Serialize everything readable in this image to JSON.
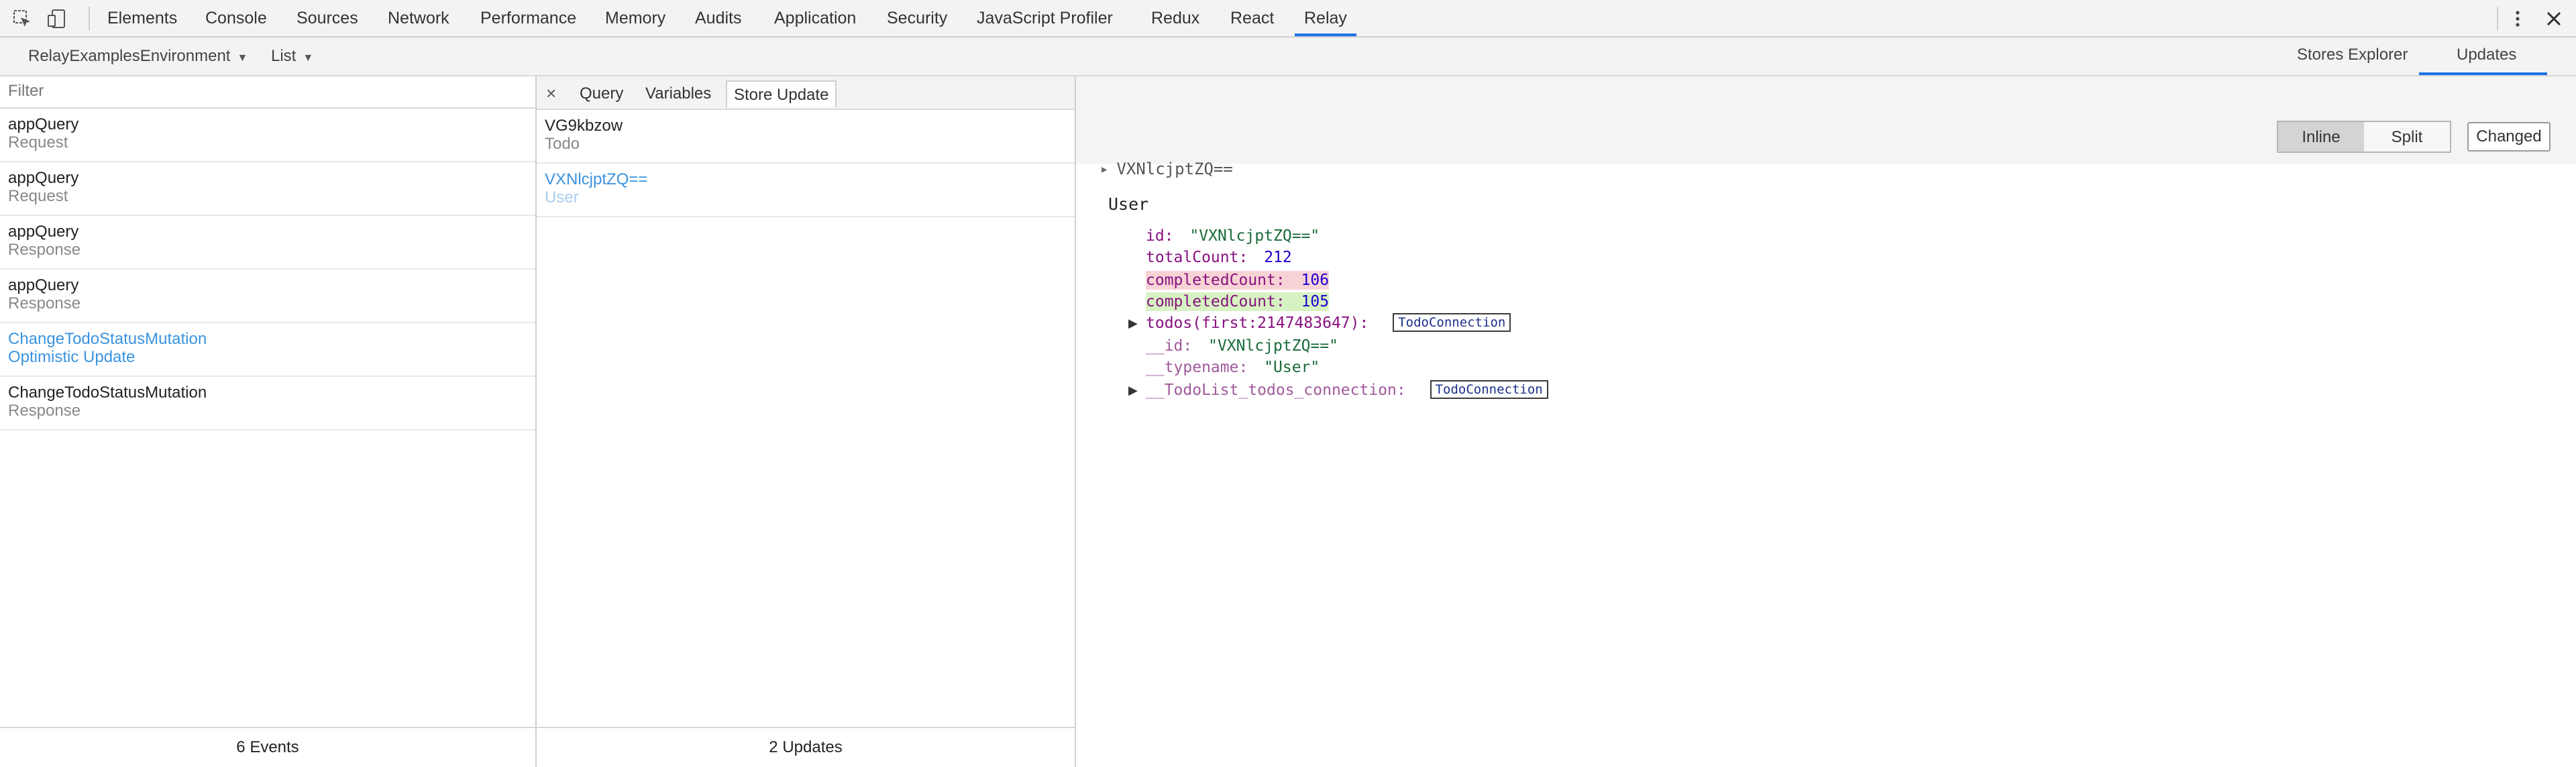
{
  "devtools": {
    "tabs": [
      "Elements",
      "Console",
      "Sources",
      "Network",
      "Performance",
      "Memory",
      "Audits",
      "Application",
      "Security",
      "JavaScript Profiler",
      "Redux",
      "React",
      "Relay"
    ],
    "active_tab": "Relay",
    "icons": {
      "inspect": "inspect-element-icon",
      "device": "device-toolbar-icon",
      "menu": "kebab-menu-icon",
      "close": "close-icon"
    }
  },
  "relay": {
    "environment": "RelayExamplesEnvironment",
    "view_mode": "List",
    "right_tabs": [
      "Stores Explorer",
      "Updates"
    ],
    "active_right_tab": "Updates"
  },
  "events": {
    "filter_placeholder": "Filter",
    "items": [
      {
        "name": "appQuery",
        "kind": "Request"
      },
      {
        "name": "appQuery",
        "kind": "Request"
      },
      {
        "name": "appQuery",
        "kind": "Response"
      },
      {
        "name": "appQuery",
        "kind": "Response"
      },
      {
        "name": "ChangeTodoStatusMutation",
        "kind": "Optimistic Update"
      },
      {
        "name": "ChangeTodoStatusMutation",
        "kind": "Response"
      }
    ],
    "footer": "6 Events"
  },
  "updates": {
    "tabs": [
      "Query",
      "Variables",
      "Store Update"
    ],
    "active_tab": "Store Update",
    "close_glyph": "×",
    "items": [
      {
        "id": "VG9kbzow",
        "type": "Todo"
      },
      {
        "id": "VXNlcjptZQ==",
        "type": "User"
      }
    ],
    "footer": "2 Updates"
  },
  "detail": {
    "toggle": [
      "Inline",
      "Split"
    ],
    "toggle_active": "Inline",
    "changed_label": "Changed",
    "record_id": "VXNlcjptZQ==",
    "record_type": "User",
    "fields": {
      "id_key": "id:",
      "id_val": "\"VXNlcjptZQ==\"",
      "total_key": "totalCount:",
      "total_val": "212",
      "completed_old_key": "completedCount:",
      "completed_old_val": "106",
      "completed_new_key": "completedCount:",
      "completed_new_val": "105",
      "todos_key": "todos(first:2147483647):",
      "todos_badge": "TodoConnection",
      "uid_key": "__id:",
      "uid_val": "\"VXNlcjptZQ==\"",
      "typename_key": "__typename:",
      "typename_val": "\"User\"",
      "conn_key": "__TodoList_todos_connection:",
      "conn_badge": "TodoConnection"
    }
  }
}
